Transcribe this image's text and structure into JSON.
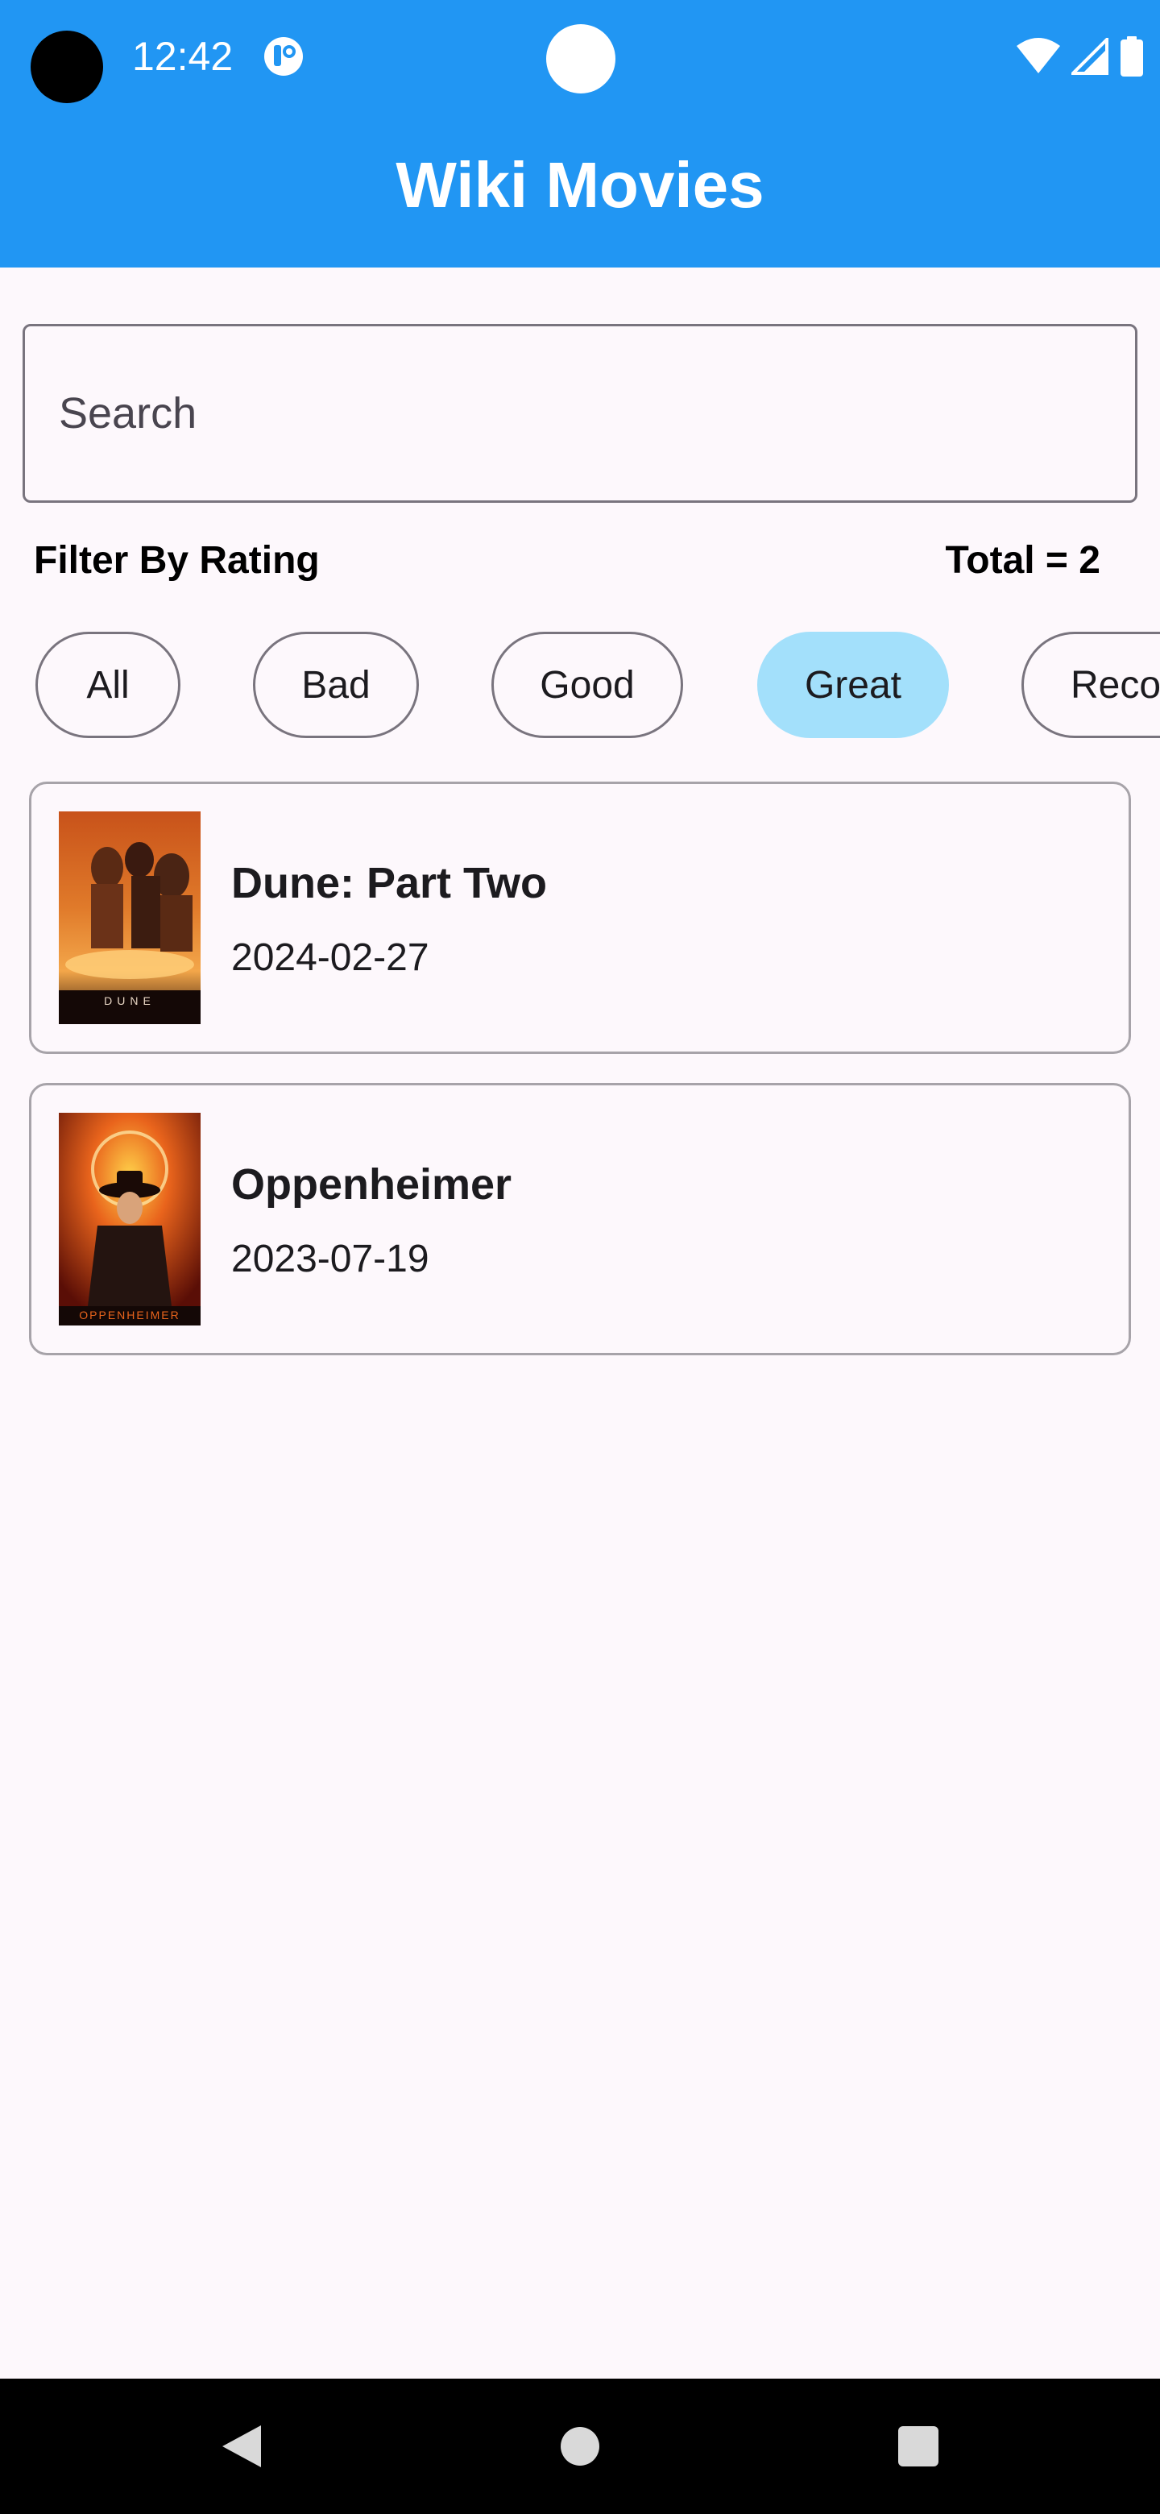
{
  "status_bar": {
    "time": "12:42",
    "icons": [
      "camera-cutout",
      "app-notification-icon",
      "wifi-icon",
      "cell-signal-icon",
      "battery-icon"
    ]
  },
  "app_bar": {
    "title": "Wiki Movies",
    "color": "#2196f3"
  },
  "search": {
    "placeholder": "Search",
    "value": ""
  },
  "filter": {
    "label": "Filter By Rating",
    "total_text": "Total = 2",
    "chips": [
      {
        "label": "All",
        "selected": false
      },
      {
        "label": "Bad",
        "selected": false
      },
      {
        "label": "Good",
        "selected": false
      },
      {
        "label": "Great",
        "selected": true
      },
      {
        "label": "Reco",
        "selected": false
      }
    ],
    "selected_color": "#a3e0fb"
  },
  "movies": [
    {
      "title": "Dune: Part Two",
      "date": "2024-02-27",
      "poster_text": "DUNE"
    },
    {
      "title": "Oppenheimer",
      "date": "2023-07-19",
      "poster_text": "OPPENHEIMER"
    }
  ],
  "nav_bar": {
    "icons": [
      "back-icon",
      "home-icon",
      "recents-icon"
    ]
  }
}
